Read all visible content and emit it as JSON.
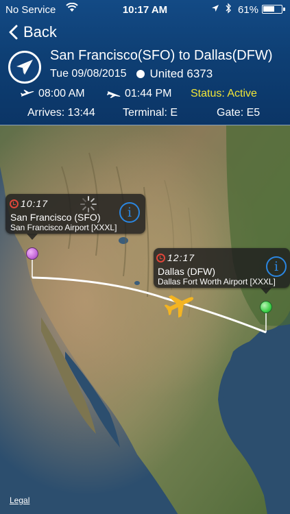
{
  "status_bar": {
    "carrier": "No Service",
    "time": "10:17 AM",
    "battery": "61%",
    "battery_level": 0.61,
    "icons": [
      "wifi-icon",
      "location-arrow-icon",
      "bluetooth-icon",
      "battery-icon"
    ]
  },
  "nav": {
    "back_label": "Back"
  },
  "flight": {
    "route": "San Francisco(SFO) to Dallas(DFW)",
    "date": "Tue 09/08/2015",
    "flight_number": "United 6373",
    "departure_time": "08:00 AM",
    "arrival_time": "01:44 PM",
    "status": "Status: Active",
    "arrives": "Arrives: 13:44",
    "terminal": "Terminal: E",
    "gate": "Gate: E5"
  },
  "map": {
    "origin": {
      "time": "10:17",
      "name": "San Francisco (SFO)",
      "airport": "San Francisco Airport [XXXL]",
      "pin_color": "#c56ad9"
    },
    "destination": {
      "time": "12:17",
      "name": "Dallas (DFW)",
      "airport": "Dallas Fort Worth Airport [XXXL]",
      "pin_color": "#3fd24a"
    },
    "plane_color": "#f3b422",
    "legal_label": "Legal"
  },
  "colors": {
    "header_bg": "#0e3f74",
    "status_active": "#f2e637",
    "info_blue": "#2b86e0",
    "clock_red": "#e0463a"
  }
}
